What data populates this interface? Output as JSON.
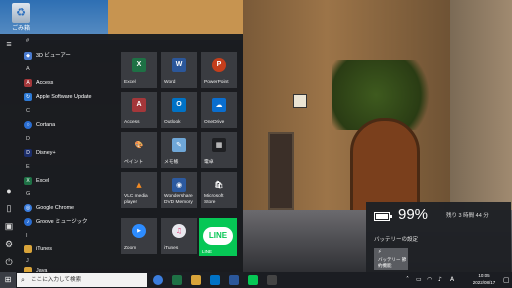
{
  "desktop": {
    "recycle_bin_label": "ごみ箱"
  },
  "start_menu": {
    "rail_icons": [
      "hamburger-icon",
      "user-icon",
      "document-icon",
      "picture-icon",
      "settings-icon",
      "power-icon"
    ],
    "section_letters": [
      "#",
      "A",
      "C",
      "D",
      "E",
      "G",
      "I",
      "J"
    ],
    "apps": [
      {
        "label": "3D ビューアー",
        "icon": "3d-viewer-icon",
        "color": "#4a7bd0"
      },
      {
        "label": "Access",
        "icon": "access-icon",
        "color": "#a4373a"
      },
      {
        "label": "Apple Software Update",
        "icon": "apple-update-icon",
        "color": "#2d7ad6"
      },
      {
        "label": "Cortana",
        "icon": "cortana-icon",
        "color": "#2a6dd1"
      },
      {
        "label": "Disney+",
        "icon": "disney-icon",
        "color": "#1b2d6b"
      },
      {
        "label": "Excel",
        "icon": "excel-icon",
        "color": "#1e7145"
      },
      {
        "label": "Google Chrome",
        "icon": "chrome-icon",
        "color": "#3b7ddd"
      },
      {
        "label": "Groove ミュージック",
        "icon": "groove-icon",
        "color": "#2a6dd1"
      },
      {
        "label": "iTunes",
        "icon": "folder-icon",
        "color": "#d9a43a"
      },
      {
        "label": "Java",
        "icon": "folder-icon",
        "color": "#d9a43a"
      }
    ],
    "tiles": [
      {
        "label": "Excel",
        "icon": "excel-icon",
        "color": "#1e7145",
        "glyph": "X"
      },
      {
        "label": "Word",
        "icon": "word-icon",
        "color": "#2b579a",
        "glyph": "W"
      },
      {
        "label": "PowerPoint",
        "icon": "powerpoint-icon",
        "color": "#c43e1c",
        "glyph": "P"
      },
      {
        "label": "Access",
        "icon": "access-icon",
        "color": "#a4373a",
        "glyph": "A"
      },
      {
        "label": "Outlook",
        "icon": "outlook-icon",
        "color": "#0072c6",
        "glyph": "O"
      },
      {
        "label": "OneDrive",
        "icon": "onedrive-icon",
        "color": "#0a6ecf",
        "glyph": "☁"
      },
      {
        "label": "ペイント",
        "icon": "paint-icon",
        "color": "#5a5c61",
        "glyph": "🎨"
      },
      {
        "label": "メモ帳",
        "icon": "notepad-icon",
        "color": "#5a5c61",
        "glyph": "✎"
      },
      {
        "label": "電卓",
        "icon": "calculator-icon",
        "color": "#2a2b2e",
        "glyph": "▦"
      },
      {
        "label": "VLC media player",
        "icon": "vlc-icon",
        "color": "#e67e22",
        "glyph": "▲"
      },
      {
        "label": "Wondershare DVD Memory",
        "icon": "dvd-memory-icon",
        "color": "#2c5aa0",
        "glyph": "◉"
      },
      {
        "label": "Microsoft Store",
        "icon": "store-icon",
        "color": "#2b2b2b",
        "glyph": "🛍"
      },
      {
        "label": "Zoom",
        "icon": "zoom-icon",
        "color": "#2d8cff",
        "glyph": "▶"
      },
      {
        "label": "iTunes",
        "icon": "itunes-icon",
        "color": "#e8e8ee",
        "glyph": "♫"
      }
    ],
    "line_tile": {
      "logo": "LINE",
      "label": "LINE"
    }
  },
  "battery_flyout": {
    "percent": "99%",
    "remaining": "残り 3 時間 44 分",
    "settings_link": "バッテリーの設定",
    "saver_label": "バッテリー 節約機能"
  },
  "taskbar": {
    "search_placeholder": "ここに入力して検索",
    "pinned": [
      "chrome-icon",
      "excel-icon",
      "file-explorer-icon",
      "outlook-icon",
      "word-icon",
      "line-icon",
      "store-icon"
    ],
    "tray_ime": "A",
    "clock_time": "10:05",
    "clock_date": "2022/08/17"
  }
}
